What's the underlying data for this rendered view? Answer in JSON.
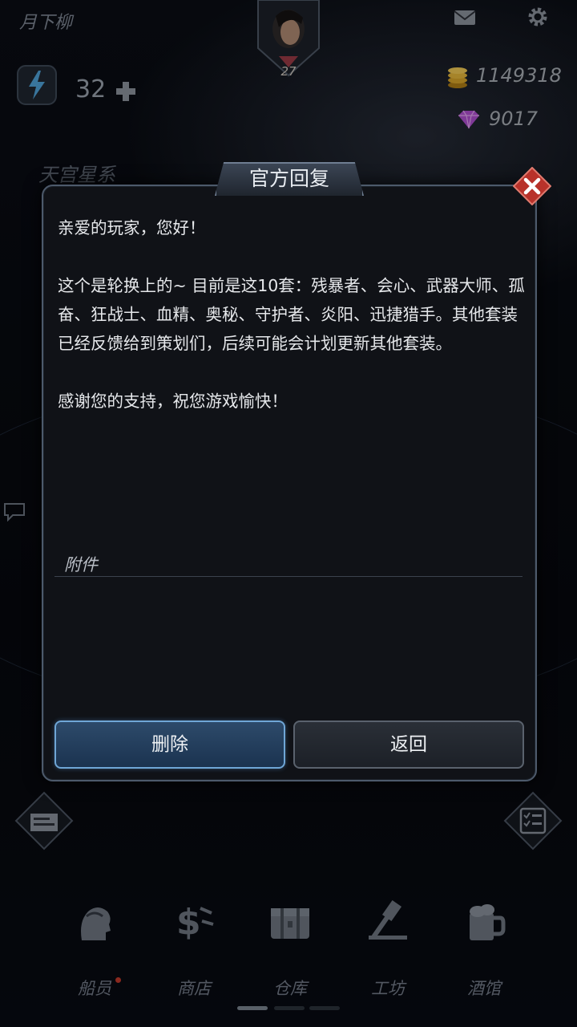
{
  "header": {
    "player_name": "月下柳",
    "avatar_level": "27",
    "energy": "32",
    "coins": "1149318",
    "gems": "9017",
    "galaxy_name": "天宫星系"
  },
  "nav": {
    "items": [
      {
        "label": "船员",
        "icon": "crew-icon"
      },
      {
        "label": "商店",
        "icon": "shop-icon"
      },
      {
        "label": "仓库",
        "icon": "warehouse-icon"
      },
      {
        "label": "工坊",
        "icon": "workshop-icon"
      },
      {
        "label": "酒馆",
        "icon": "tavern-icon"
      }
    ]
  },
  "dialog": {
    "title": "官方回复",
    "greeting": "亲爱的玩家，您好！",
    "body": "这个是轮换上的~ 目前是这10套：残暴者、会心、武器大师、孤奋、狂战士、血精、奥秘、守护者、炎阳、迅捷猎手。其他套装已经反馈给到策划们，后续可能会计划更新其他套装。",
    "thanks": "感谢您的支持，祝您游戏愉快！",
    "attachments_label": "附件",
    "delete_label": "删除",
    "back_label": "返回"
  },
  "colors": {
    "accent_blue": "#6fa6d6",
    "close_red": "#c0392b",
    "gem_purple": "#b04fd1",
    "coin_gold": "#d9a52a"
  }
}
